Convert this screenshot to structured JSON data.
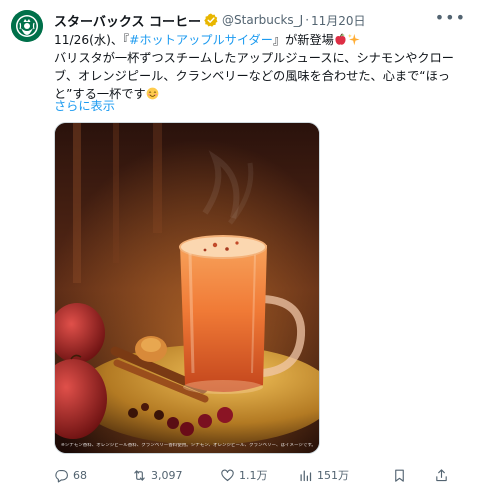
{
  "tweet": {
    "author": {
      "display_name": "スターバックス コーヒー",
      "handle": "@Starbucks_J",
      "verified": true
    },
    "separator": "·",
    "date": "11月20日",
    "text": {
      "line1_prefix": "11/26(水)、『",
      "hashtag": "#ホットアップルサイダー",
      "line1_suffix": "』が新登場",
      "line2": "バリスタが一杯ずつスチームしたアップルジュースに、シナモンやクロー",
      "line3": "ブ、オレンジピール、クランベリーなどの風味を合わせた、心まで“ほっ",
      "line4": "と”する一杯です"
    },
    "show_more": "さらに表示",
    "image_caption": "※シナモン香料、オレンジピール香料、クランベリー香料使用。シナモン、オレンジピール、クランベリー、はイメージです。",
    "stats": {
      "replies": "68",
      "reposts": "3,097",
      "likes": "1.1万",
      "views": "151万"
    }
  },
  "colors": {
    "accent": "#1d9bf0",
    "muted": "#536471",
    "text": "#0f1419",
    "brand": "#00704a",
    "verified": "#e8b600"
  },
  "icons": [
    "starbucks-logo-icon",
    "verified-badge-icon",
    "more-icon",
    "apple-emoji-icon",
    "sparkles-emoji-icon",
    "smile-emoji-icon",
    "reply-icon",
    "repost-icon",
    "like-icon",
    "views-icon",
    "bookmark-icon",
    "share-icon"
  ]
}
